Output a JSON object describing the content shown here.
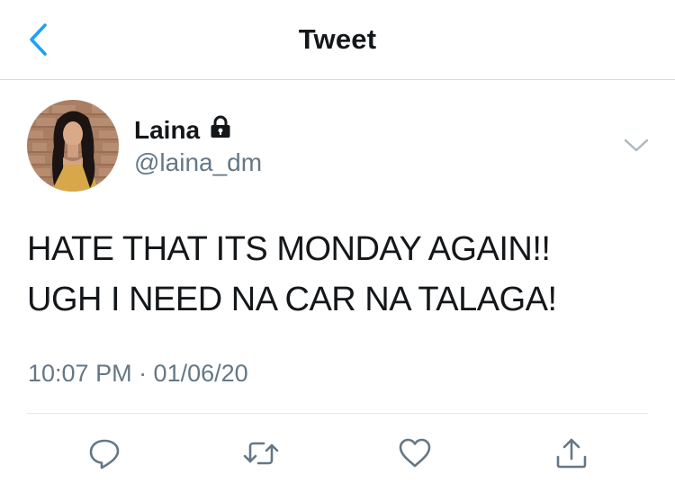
{
  "header": {
    "title": "Tweet",
    "back_icon": "chevron-left-icon"
  },
  "author": {
    "display_name": "Laina",
    "handle": "@laina_dm",
    "protected_icon": "lock-icon"
  },
  "tweet": {
    "lines": [
      "HATE THAT ITS MONDAY AGAIN!!",
      "UGH I NEED NA CAR NA TALAGA!"
    ],
    "timestamp": "10:07 PM · 01/06/20"
  },
  "actions": {
    "icons": [
      "reply-icon",
      "retweet-icon",
      "like-icon",
      "share-icon"
    ]
  },
  "colors": {
    "accent": "#1da1f2",
    "secondary_text": "#657786",
    "divider": "#e1e8ed"
  }
}
